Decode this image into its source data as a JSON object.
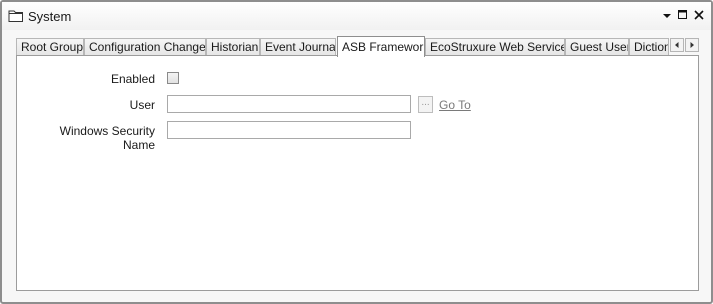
{
  "window": {
    "title": "System",
    "icons": {
      "title": "folder-icon",
      "pin": "dropdown-arrow-icon",
      "maximize": "maximize-icon",
      "close": "close-icon"
    }
  },
  "tabs": [
    {
      "label": "Root Group",
      "active": false
    },
    {
      "label": "Configuration Changes",
      "active": false
    },
    {
      "label": "Historian",
      "active": false
    },
    {
      "label": "Event Journal",
      "active": false
    },
    {
      "label": "ASB Framework",
      "active": true
    },
    {
      "label": "EcoStruxure Web Services",
      "active": false
    },
    {
      "label": "Guest User",
      "active": false
    },
    {
      "label": "Dictionary",
      "active": false
    }
  ],
  "tab_scroll": {
    "left_icon": "scroll-left-icon",
    "right_icon": "scroll-right-icon"
  },
  "form": {
    "enabled_label": "Enabled",
    "enabled_checked": false,
    "user_label": "User",
    "user_value": "",
    "browse_label": "...",
    "goto_label": "Go To",
    "windows_security_label": "Windows Security Name",
    "windows_security_value": ""
  }
}
